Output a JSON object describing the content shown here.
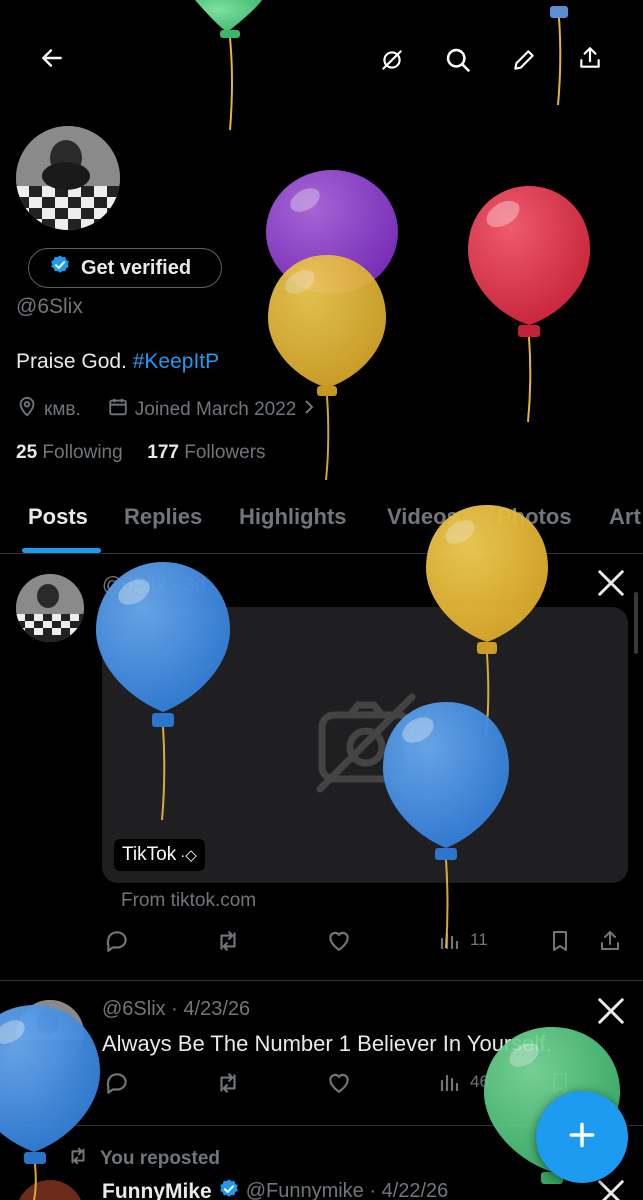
{
  "profile": {
    "get_verified_label": "Get verified",
    "handle": "@6Slix",
    "bio_text": "Praise God.",
    "bio_hashtag": "#KeepItP",
    "location": "кмв.",
    "joined": "Joined March 2022",
    "following_count": "25",
    "following_label": "Following",
    "followers_count": "177",
    "followers_label": "Followers"
  },
  "tabs": [
    "Posts",
    "Replies",
    "Highlights",
    "Videos",
    "Photos",
    "Art"
  ],
  "post1": {
    "header": "@6Slix · 3d",
    "card_source_pill": "TikTok",
    "card_source_pill_icon": "·◇",
    "from": "From tiktok.com",
    "views": "11"
  },
  "post2": {
    "header": "@6Slix · 4/23/26",
    "text": "Always Be The Number 1 Believer In Yourself.",
    "views": "46"
  },
  "post3": {
    "repost_label": "You reposted",
    "author_name": "FunnyMike",
    "header": "@Funnymike · 4/22/26"
  },
  "colors": {
    "accent": "#1d9bf0",
    "muted": "#71767b",
    "text": "#e7e9ea",
    "background": "#000000",
    "divider": "#2f3336"
  },
  "icons": {
    "back": "arrow-left-icon",
    "mute": "mute-icon",
    "search": "search-icon",
    "edit": "pencil-icon",
    "share": "share-icon",
    "location": "location-pin-icon",
    "calendar": "calendar-icon",
    "reply": "reply-icon",
    "repost": "repost-icon",
    "like": "heart-icon",
    "views": "views-icon",
    "bookmark": "bookmark-icon",
    "x_logo": "x-logo-icon",
    "compose": "plus-icon"
  }
}
